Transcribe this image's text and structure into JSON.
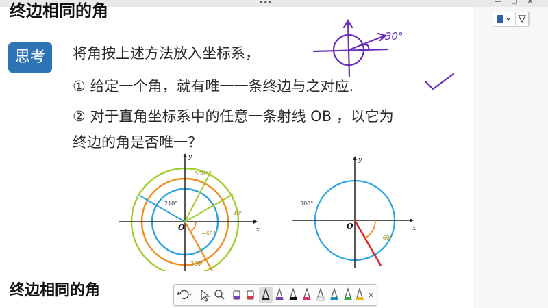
{
  "slide": {
    "top_title": "终边相同的角",
    "think_label": "思考",
    "line1": "将角按上述方法放入坐标系，",
    "line2_prefix": "① 给定一个角，就有唯一一条终边与之对应",
    "line3": "② 对于直角坐标系中的任意一条射线 OB ，以它为",
    "line4": "终边的角是否唯一？",
    "bottom_title": "终边相同的角"
  },
  "figure_left": {
    "axis_x": "x",
    "axis_y": "y",
    "origin": "O",
    "label_300_top": "300°",
    "label_210": "210°",
    "label_30": "30°",
    "label_neg60": "−60°",
    "label_300_bottom": "300°"
  },
  "figure_right": {
    "axis_x": "x",
    "axis_y": "y",
    "origin": "O",
    "label_300": "300°",
    "label_neg60": "−60°"
  },
  "handwriting": {
    "annotation": "30°"
  },
  "pen_toolbar": {
    "tools": [
      "undo-icon",
      "cursor-icon",
      "search-icon",
      "highlighter-purple-icon",
      "eraser-icon",
      "pen-black-icon",
      "pen-purple-icon",
      "pen-red-icon",
      "pen-pink-icon",
      "pen-outline-icon",
      "pen-blue-icon",
      "pen-green-icon",
      "pen-yellow-icon",
      "close-icon"
    ],
    "close_glyph": "✕"
  },
  "colors": {
    "think_bg": "#2e74b5",
    "ink": "#6a2fb7",
    "orange": "#f08a1c",
    "green": "#9fcc2e",
    "blue": "#2aa3e0",
    "red": "#d62828"
  }
}
